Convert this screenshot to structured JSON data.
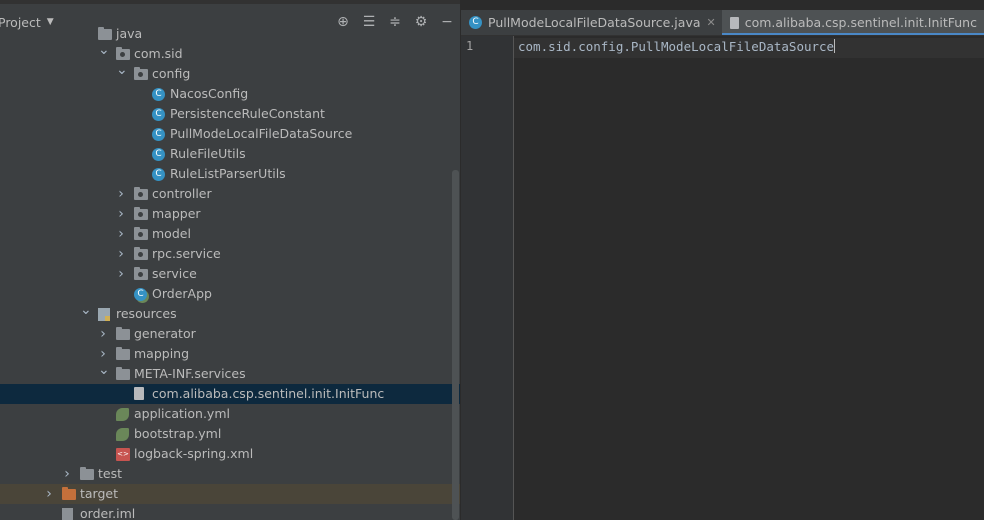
{
  "project_panel": {
    "title": "Project",
    "toolbar_icons": [
      "locate-icon",
      "expand-all-icon",
      "collapse-all-icon",
      "gear-icon",
      "minimize-icon"
    ],
    "tree": [
      {
        "label": "java",
        "indent": 0,
        "arrow": "",
        "icon": "folder"
      },
      {
        "label": "com.sid",
        "indent": 1,
        "arrow": "open",
        "icon": "package"
      },
      {
        "label": "config",
        "indent": 2,
        "arrow": "open",
        "icon": "package"
      },
      {
        "label": "NacosConfig",
        "indent": 3,
        "arrow": "",
        "icon": "class"
      },
      {
        "label": "PersistenceRuleConstant",
        "indent": 3,
        "arrow": "",
        "icon": "class"
      },
      {
        "label": "PullModeLocalFileDataSource",
        "indent": 3,
        "arrow": "",
        "icon": "class"
      },
      {
        "label": "RuleFileUtils",
        "indent": 3,
        "arrow": "",
        "icon": "class"
      },
      {
        "label": "RuleListParserUtils",
        "indent": 3,
        "arrow": "",
        "icon": "class"
      },
      {
        "label": "controller",
        "indent": 2,
        "arrow": "closed",
        "icon": "package"
      },
      {
        "label": "mapper",
        "indent": 2,
        "arrow": "closed",
        "icon": "package"
      },
      {
        "label": "model",
        "indent": 2,
        "arrow": "closed",
        "icon": "package"
      },
      {
        "label": "rpc.service",
        "indent": 2,
        "arrow": "closed",
        "icon": "package"
      },
      {
        "label": "service",
        "indent": 2,
        "arrow": "closed",
        "icon": "package"
      },
      {
        "label": "OrderApp",
        "indent": 2,
        "arrow": "",
        "icon": "spring-class"
      },
      {
        "label": "resources",
        "indent": 0,
        "arrow": "open",
        "icon": "resources"
      },
      {
        "label": "generator",
        "indent": 1,
        "arrow": "closed",
        "icon": "folder"
      },
      {
        "label": "mapping",
        "indent": 1,
        "arrow": "closed",
        "icon": "folder"
      },
      {
        "label": "META-INF.services",
        "indent": 1,
        "arrow": "open",
        "icon": "folder"
      },
      {
        "label": "com.alibaba.csp.sentinel.init.InitFunc",
        "indent": 2,
        "arrow": "",
        "icon": "file",
        "selected": true
      },
      {
        "label": "application.yml",
        "indent": 1,
        "arrow": "",
        "icon": "spring-yml"
      },
      {
        "label": "bootstrap.yml",
        "indent": 1,
        "arrow": "",
        "icon": "spring-yml"
      },
      {
        "label": "logback-spring.xml",
        "indent": 1,
        "arrow": "",
        "icon": "xml"
      },
      {
        "label": "test",
        "indent": -1,
        "arrow": "closed",
        "icon": "folder"
      },
      {
        "label": "target",
        "indent": -2,
        "arrow": "closed",
        "icon": "target-folder",
        "highlight": true
      },
      {
        "label": "order.iml",
        "indent": -2,
        "arrow": "",
        "icon": "iml"
      }
    ]
  },
  "editor": {
    "tabs": [
      {
        "label": "PullModeLocalFileDataSource.java",
        "icon": "class-icon",
        "active": false
      },
      {
        "label": "com.alibaba.csp.sentinel.init.InitFunc",
        "icon": "text-file-icon",
        "active": true
      },
      {
        "label": "",
        "icon": "class-icon",
        "active": false
      }
    ],
    "line_number": "1",
    "code_line": "com.sid.config.PullModeLocalFileDataSource"
  },
  "colors": {
    "panel_bg": "#3c3f41",
    "editor_bg": "#2b2b2b",
    "selection": "#0d293e",
    "tab_accent": "#4a88c7"
  }
}
